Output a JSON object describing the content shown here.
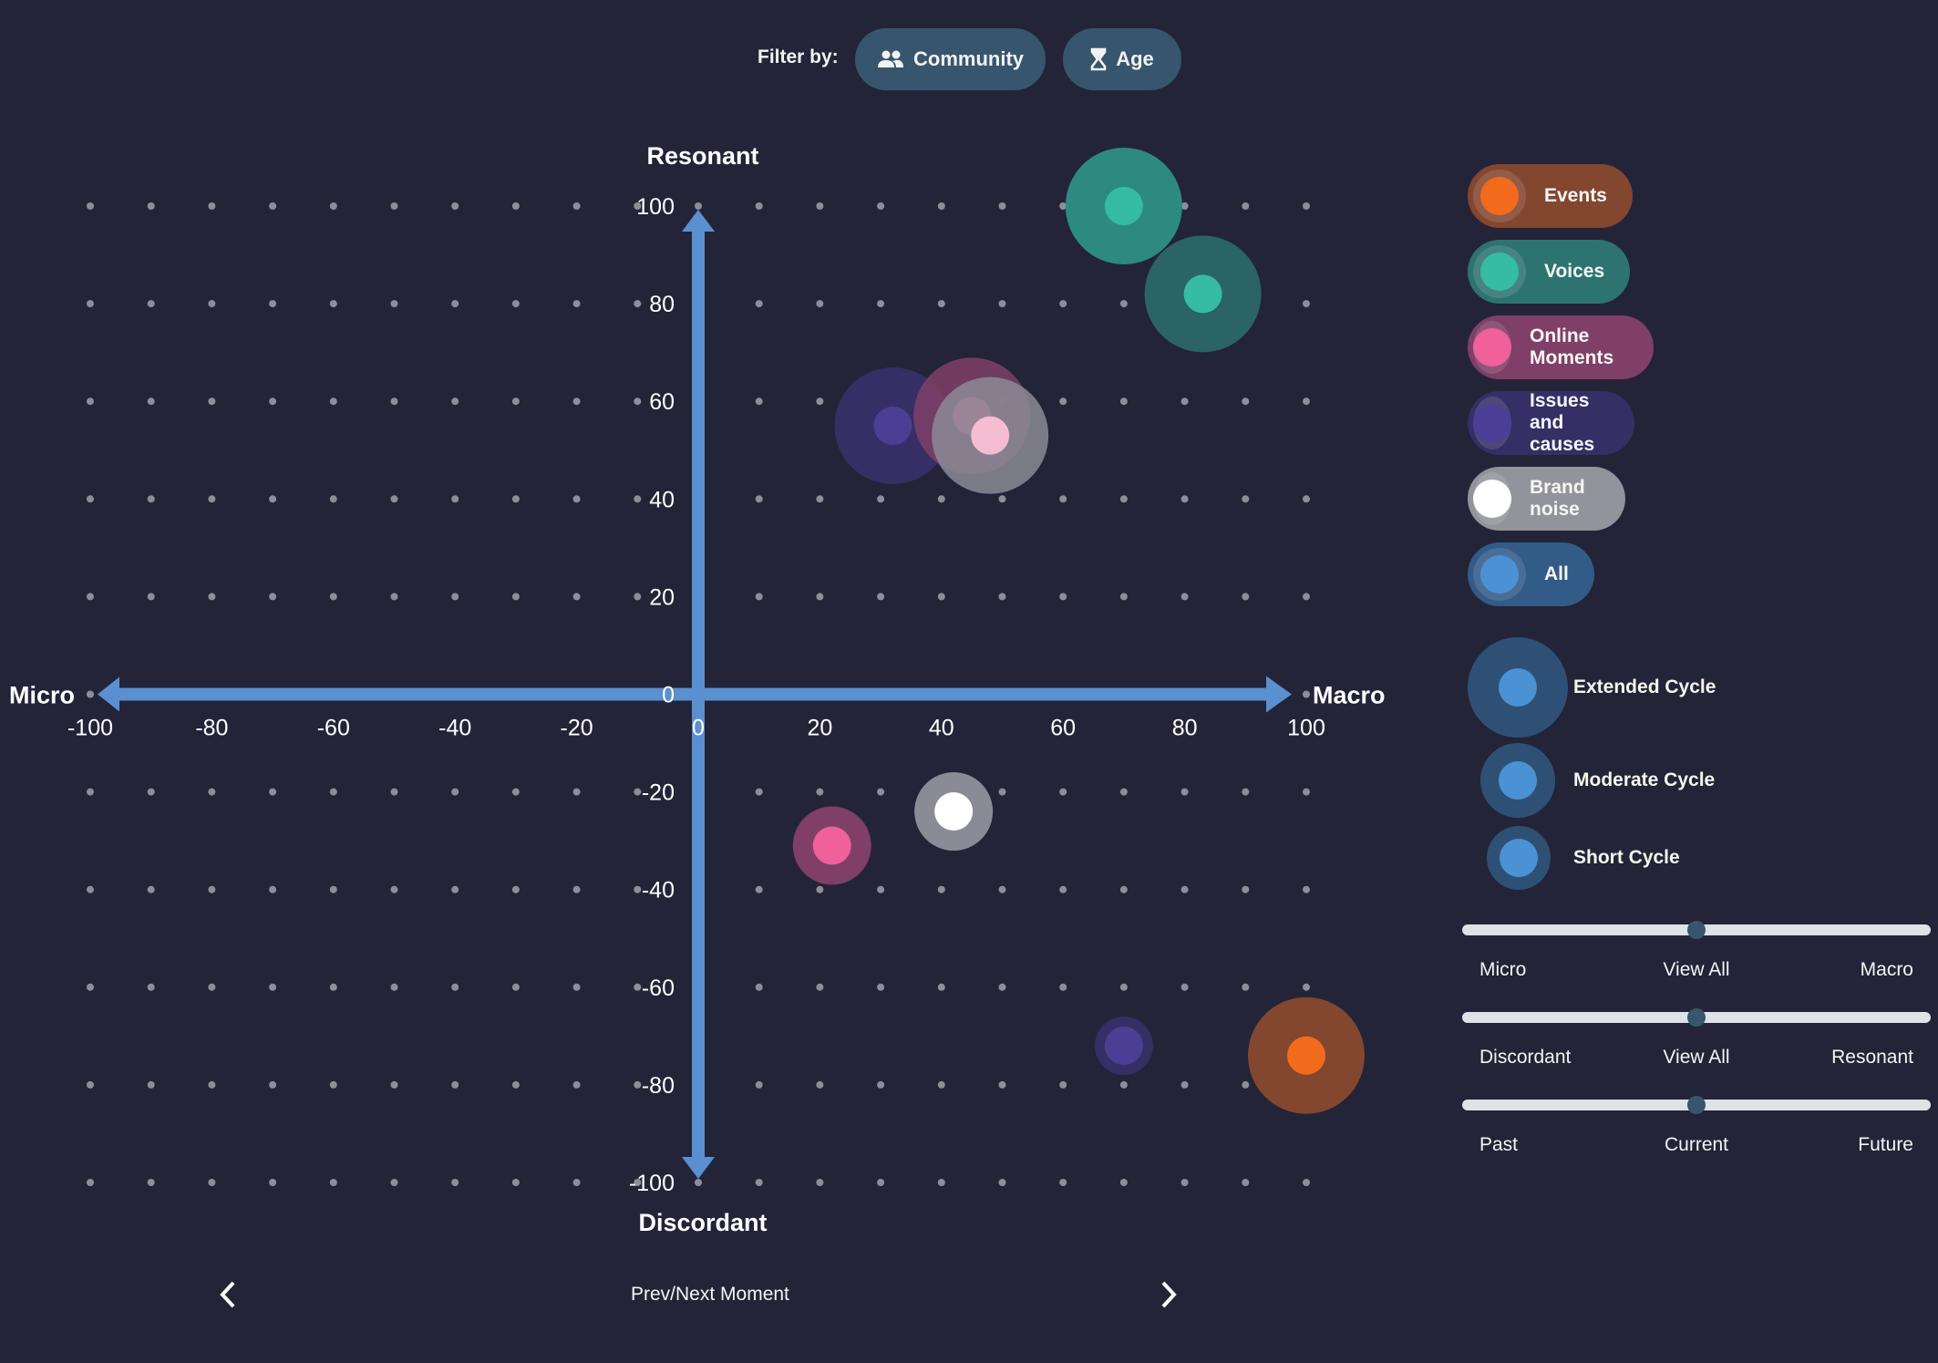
{
  "filter": {
    "label": "Filter by:",
    "buttons": [
      {
        "label": "Community",
        "icon": "people-icon"
      },
      {
        "label": "Age",
        "icon": "hourglass-icon"
      }
    ]
  },
  "legend": {
    "categories": [
      {
        "label": "Events",
        "color": "#f26b1d",
        "bg": "#83462f"
      },
      {
        "label": "Voices",
        "color": "#35bca3",
        "bg": "#2d7470"
      },
      {
        "label": "Online Moments",
        "color": "#f0609a",
        "bg": "#7f3f67"
      },
      {
        "label": "Issues and causes",
        "color": "#4d3e95",
        "bg": "#352f66"
      },
      {
        "label": "Brand noise",
        "color": "#ffffff",
        "bg": "#93939b"
      },
      {
        "label": "All",
        "color": "#4a92d4",
        "bg": "#325b87"
      }
    ],
    "cycles": [
      {
        "label": "Extended Cycle"
      },
      {
        "label": "Moderate Cycle"
      },
      {
        "label": "Short Cycle"
      }
    ]
  },
  "sliders": [
    {
      "left": "Micro",
      "mid": "View All",
      "right": "Macro",
      "value": 0.5
    },
    {
      "left": "Discordant",
      "mid": "View All",
      "right": "Resonant",
      "value": 0.5
    },
    {
      "left": "Past",
      "mid": "Current",
      "right": "Future",
      "value": 0.5
    }
  ],
  "nav": {
    "label": "Prev/Next Moment"
  },
  "chart_data": {
    "type": "scatter",
    "title": "",
    "xlabel_left": "Micro",
    "xlabel_right": "Macro",
    "ylabel_top": "Resonant",
    "ylabel_bottom": "Discordant",
    "xlim": [
      -100,
      100
    ],
    "ylim": [
      -100,
      100
    ],
    "x_ticks": [
      -100,
      -80,
      -60,
      -40,
      -20,
      0,
      20,
      40,
      60,
      80,
      100
    ],
    "y_ticks": [
      100,
      80,
      60,
      40,
      20,
      0,
      -20,
      -40,
      -60,
      -80,
      -100
    ],
    "grid": "dots",
    "legend_position": "right",
    "points": [
      {
        "category": "Voices",
        "x": 70,
        "y": 100,
        "cycle": "Extended Cycle"
      },
      {
        "category": "Voices",
        "x": 83,
        "y": 82,
        "cycle": "Extended Cycle"
      },
      {
        "category": "Issues and causes",
        "x": 32,
        "y": 55,
        "cycle": "Extended Cycle"
      },
      {
        "category": "Online Moments",
        "x": 45,
        "y": 57,
        "cycle": "Extended Cycle"
      },
      {
        "category": "Brand noise",
        "x": 48,
        "y": 53,
        "cycle": "Extended Cycle"
      },
      {
        "category": "Online Moments",
        "x": 22,
        "y": -31,
        "cycle": "Moderate Cycle"
      },
      {
        "category": "Brand noise",
        "x": 42,
        "y": -24,
        "cycle": "Moderate Cycle"
      },
      {
        "category": "Issues and causes",
        "x": 70,
        "y": -72,
        "cycle": "Short Cycle"
      },
      {
        "category": "Events",
        "x": 100,
        "y": -74,
        "cycle": "Extended Cycle"
      }
    ]
  }
}
